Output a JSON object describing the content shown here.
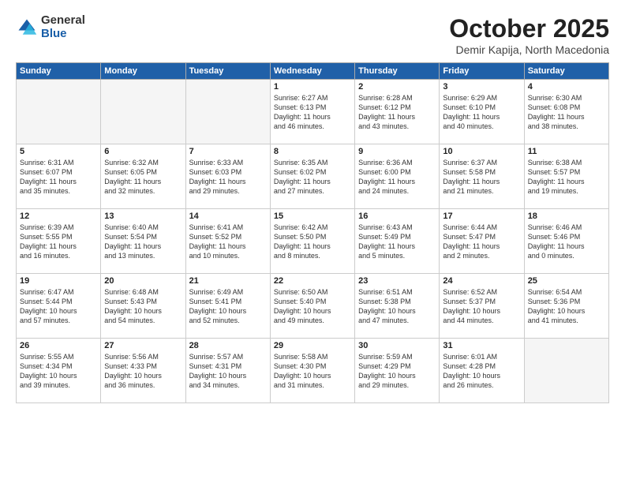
{
  "header": {
    "logo_general": "General",
    "logo_blue": "Blue",
    "month_title": "October 2025",
    "subtitle": "Demir Kapija, North Macedonia"
  },
  "weekdays": [
    "Sunday",
    "Monday",
    "Tuesday",
    "Wednesday",
    "Thursday",
    "Friday",
    "Saturday"
  ],
  "weeks": [
    [
      {
        "day": "",
        "text": ""
      },
      {
        "day": "",
        "text": ""
      },
      {
        "day": "",
        "text": ""
      },
      {
        "day": "1",
        "text": "Sunrise: 6:27 AM\nSunset: 6:13 PM\nDaylight: 11 hours\nand 46 minutes."
      },
      {
        "day": "2",
        "text": "Sunrise: 6:28 AM\nSunset: 6:12 PM\nDaylight: 11 hours\nand 43 minutes."
      },
      {
        "day": "3",
        "text": "Sunrise: 6:29 AM\nSunset: 6:10 PM\nDaylight: 11 hours\nand 40 minutes."
      },
      {
        "day": "4",
        "text": "Sunrise: 6:30 AM\nSunset: 6:08 PM\nDaylight: 11 hours\nand 38 minutes."
      }
    ],
    [
      {
        "day": "5",
        "text": "Sunrise: 6:31 AM\nSunset: 6:07 PM\nDaylight: 11 hours\nand 35 minutes."
      },
      {
        "day": "6",
        "text": "Sunrise: 6:32 AM\nSunset: 6:05 PM\nDaylight: 11 hours\nand 32 minutes."
      },
      {
        "day": "7",
        "text": "Sunrise: 6:33 AM\nSunset: 6:03 PM\nDaylight: 11 hours\nand 29 minutes."
      },
      {
        "day": "8",
        "text": "Sunrise: 6:35 AM\nSunset: 6:02 PM\nDaylight: 11 hours\nand 27 minutes."
      },
      {
        "day": "9",
        "text": "Sunrise: 6:36 AM\nSunset: 6:00 PM\nDaylight: 11 hours\nand 24 minutes."
      },
      {
        "day": "10",
        "text": "Sunrise: 6:37 AM\nSunset: 5:58 PM\nDaylight: 11 hours\nand 21 minutes."
      },
      {
        "day": "11",
        "text": "Sunrise: 6:38 AM\nSunset: 5:57 PM\nDaylight: 11 hours\nand 19 minutes."
      }
    ],
    [
      {
        "day": "12",
        "text": "Sunrise: 6:39 AM\nSunset: 5:55 PM\nDaylight: 11 hours\nand 16 minutes."
      },
      {
        "day": "13",
        "text": "Sunrise: 6:40 AM\nSunset: 5:54 PM\nDaylight: 11 hours\nand 13 minutes."
      },
      {
        "day": "14",
        "text": "Sunrise: 6:41 AM\nSunset: 5:52 PM\nDaylight: 11 hours\nand 10 minutes."
      },
      {
        "day": "15",
        "text": "Sunrise: 6:42 AM\nSunset: 5:50 PM\nDaylight: 11 hours\nand 8 minutes."
      },
      {
        "day": "16",
        "text": "Sunrise: 6:43 AM\nSunset: 5:49 PM\nDaylight: 11 hours\nand 5 minutes."
      },
      {
        "day": "17",
        "text": "Sunrise: 6:44 AM\nSunset: 5:47 PM\nDaylight: 11 hours\nand 2 minutes."
      },
      {
        "day": "18",
        "text": "Sunrise: 6:46 AM\nSunset: 5:46 PM\nDaylight: 11 hours\nand 0 minutes."
      }
    ],
    [
      {
        "day": "19",
        "text": "Sunrise: 6:47 AM\nSunset: 5:44 PM\nDaylight: 10 hours\nand 57 minutes."
      },
      {
        "day": "20",
        "text": "Sunrise: 6:48 AM\nSunset: 5:43 PM\nDaylight: 10 hours\nand 54 minutes."
      },
      {
        "day": "21",
        "text": "Sunrise: 6:49 AM\nSunset: 5:41 PM\nDaylight: 10 hours\nand 52 minutes."
      },
      {
        "day": "22",
        "text": "Sunrise: 6:50 AM\nSunset: 5:40 PM\nDaylight: 10 hours\nand 49 minutes."
      },
      {
        "day": "23",
        "text": "Sunrise: 6:51 AM\nSunset: 5:38 PM\nDaylight: 10 hours\nand 47 minutes."
      },
      {
        "day": "24",
        "text": "Sunrise: 6:52 AM\nSunset: 5:37 PM\nDaylight: 10 hours\nand 44 minutes."
      },
      {
        "day": "25",
        "text": "Sunrise: 6:54 AM\nSunset: 5:36 PM\nDaylight: 10 hours\nand 41 minutes."
      }
    ],
    [
      {
        "day": "26",
        "text": "Sunrise: 5:55 AM\nSunset: 4:34 PM\nDaylight: 10 hours\nand 39 minutes."
      },
      {
        "day": "27",
        "text": "Sunrise: 5:56 AM\nSunset: 4:33 PM\nDaylight: 10 hours\nand 36 minutes."
      },
      {
        "day": "28",
        "text": "Sunrise: 5:57 AM\nSunset: 4:31 PM\nDaylight: 10 hours\nand 34 minutes."
      },
      {
        "day": "29",
        "text": "Sunrise: 5:58 AM\nSunset: 4:30 PM\nDaylight: 10 hours\nand 31 minutes."
      },
      {
        "day": "30",
        "text": "Sunrise: 5:59 AM\nSunset: 4:29 PM\nDaylight: 10 hours\nand 29 minutes."
      },
      {
        "day": "31",
        "text": "Sunrise: 6:01 AM\nSunset: 4:28 PM\nDaylight: 10 hours\nand 26 minutes."
      },
      {
        "day": "",
        "text": ""
      }
    ]
  ]
}
